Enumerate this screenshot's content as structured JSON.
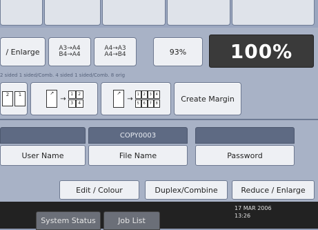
{
  "ratio_row": {
    "enlarge_label": "/ Enlarge",
    "preset_a": [
      "A3→A4",
      "B4→A4"
    ],
    "preset_b": [
      "A4→A3",
      "A4→B4"
    ],
    "percent_small": "93%",
    "percent_big": "100%"
  },
  "instruction": "2 sided 1 sided/Comb. 4 sided 1 sided/Comb. 8 orig",
  "stamp_row": {
    "icon1_pages": [
      "2",
      "1"
    ],
    "combine2_pages": [
      "1",
      "2",
      "3",
      "4"
    ],
    "combine4_pages": [
      "1",
      "2",
      "3",
      "4",
      "5",
      "6",
      "7",
      "8"
    ],
    "create_margin_label": "Create Margin"
  },
  "fields": {
    "user_name": {
      "header": "",
      "label": "User Name"
    },
    "file_name": {
      "header": "COPY0003",
      "label": "File Name"
    },
    "password": {
      "header": "",
      "label": "Password"
    }
  },
  "tabs": {
    "edit_colour": "Edit / Colour",
    "duplex_combine": "Duplex/Combine",
    "reduce_enlarge": "Reduce / Enlarge"
  },
  "bottom_bar": {
    "system_status": "System Status",
    "job_list": "Job List",
    "date": "17 MAR 2006",
    "time": "13:26"
  }
}
